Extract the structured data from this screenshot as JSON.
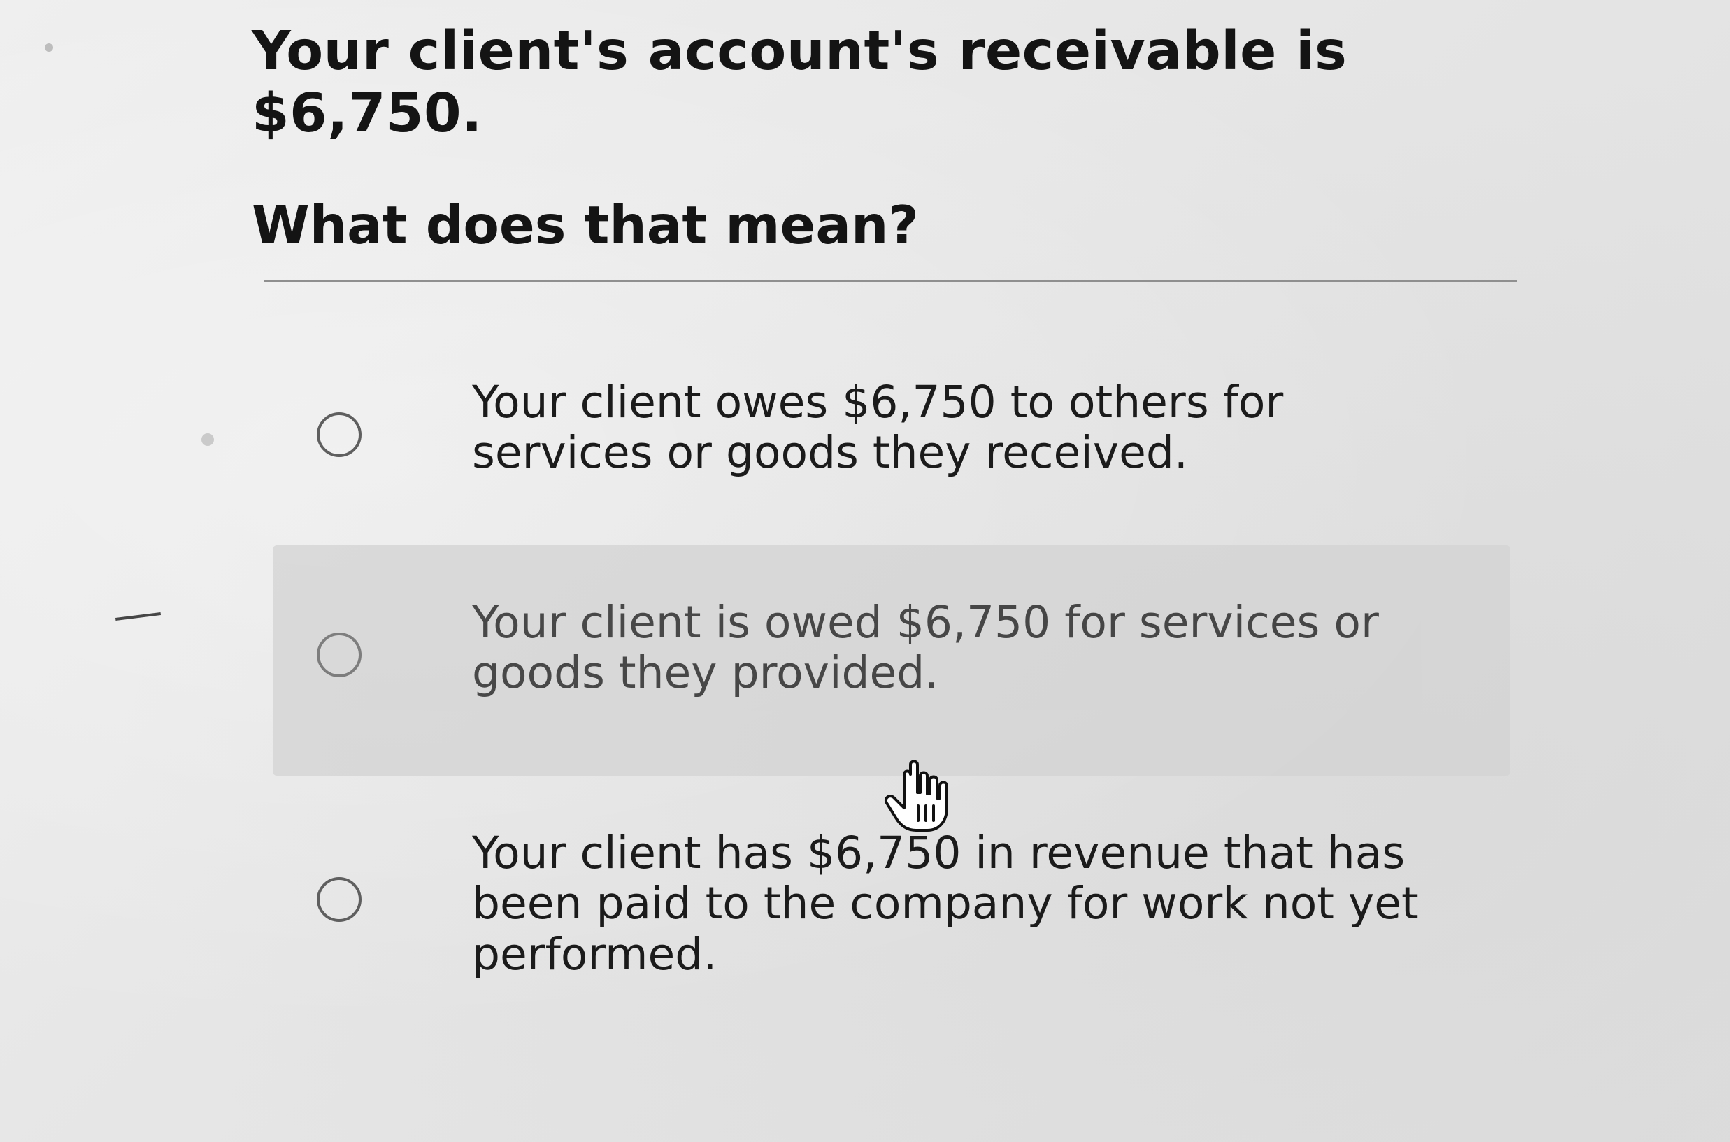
{
  "question": {
    "title": "Your client's account's receivable is $6,750.",
    "subtitle": "What does that mean?"
  },
  "options": [
    {
      "label": "Your client owes $6,750 to others for services or goods they received.",
      "selected": false
    },
    {
      "label": "Your client is owed $6,750 for services or goods they provided.",
      "selected": false
    },
    {
      "label": "Your client has $6,750 in revenue that has been paid to the company for work not yet performed.",
      "selected": false
    }
  ],
  "cursor": {
    "icon": "hand-pointer-icon"
  },
  "colors": {
    "background": "#e6e6e6",
    "text": "#141414",
    "radio_border": "#5f5f5f",
    "highlight": "#d4d4d4"
  }
}
